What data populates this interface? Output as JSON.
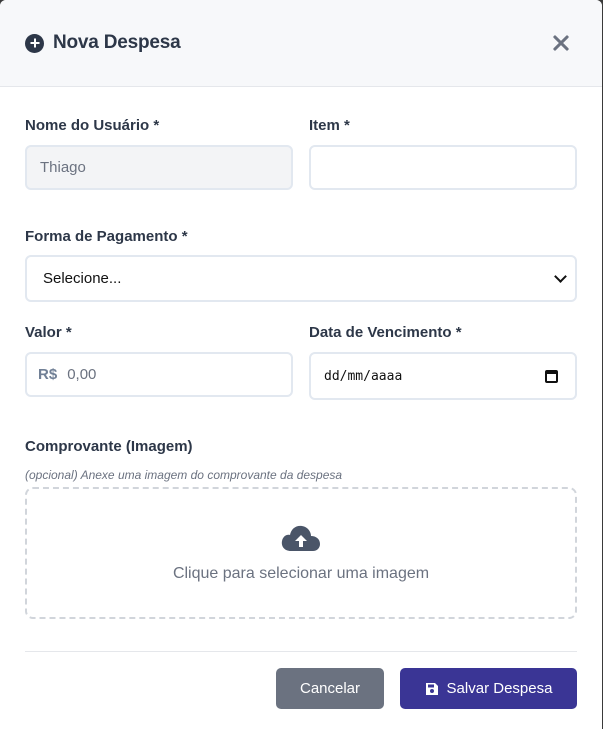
{
  "modal": {
    "title": "Nova Despesa",
    "header_icon": "plus-circle-icon",
    "close_icon": "close-icon"
  },
  "form": {
    "user_label": "Nome do Usuário *",
    "user_value": "Thiago",
    "item_label": "Item *",
    "item_value": "",
    "payment_label": "Forma de Pagamento *",
    "payment_selected": "Selecione...",
    "value_label": "Valor *",
    "value_prefix": "R$",
    "value_placeholder": "0,00",
    "due_date_label": "Data de Vencimento *",
    "due_date_placeholder": "dd/mm/aaaa",
    "receipt_label": "Comprovante (Imagem)",
    "receipt_hint": "(opcional) Anexe uma imagem do comprovante da despesa",
    "upload_text": "Clique para selecionar uma imagem",
    "upload_icon": "cloud-upload-icon"
  },
  "footer": {
    "cancel_label": "Cancelar",
    "save_label": "Salvar Despesa",
    "save_icon": "floppy-disk-icon"
  },
  "colors": {
    "primary": "#3a3595",
    "secondary": "#6b7280",
    "text": "#2d3748"
  }
}
